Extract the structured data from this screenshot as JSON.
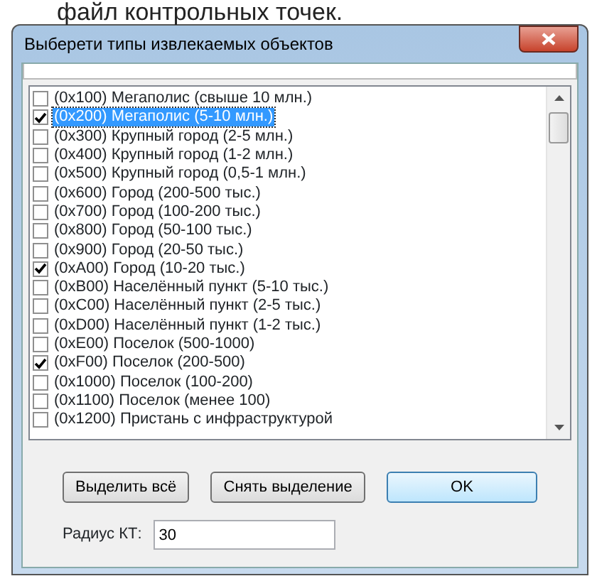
{
  "caption": "файл контрольных точек.",
  "window": {
    "title": "Выберети типы извлекаемых объектов"
  },
  "items": [
    {
      "label": "(0x100) Мегаполис (свыше 10 млн.)",
      "checked": false,
      "selected": false
    },
    {
      "label": "(0x200) Мегаполис (5-10 млн.)",
      "checked": true,
      "selected": true
    },
    {
      "label": "(0x300) Крупный город (2-5 млн.)",
      "checked": false,
      "selected": false
    },
    {
      "label": "(0x400) Крупный город (1-2 млн.)",
      "checked": false,
      "selected": false
    },
    {
      "label": "(0x500) Крупный город (0,5-1 млн.)",
      "checked": false,
      "selected": false
    },
    {
      "label": "(0x600) Город (200-500 тыс.)",
      "checked": false,
      "selected": false
    },
    {
      "label": "(0x700) Город (100-200 тыс.)",
      "checked": false,
      "selected": false
    },
    {
      "label": "(0x800) Город (50-100 тыс.)",
      "checked": false,
      "selected": false
    },
    {
      "label": "(0x900) Город (20-50 тыс.)",
      "checked": false,
      "selected": false
    },
    {
      "label": "(0xA00) Город (10-20 тыс.)",
      "checked": true,
      "selected": false
    },
    {
      "label": "(0xB00) Населённый пункт (5-10 тыс.)",
      "checked": false,
      "selected": false
    },
    {
      "label": "(0xC00) Населённый пункт (2-5 тыс.)",
      "checked": false,
      "selected": false
    },
    {
      "label": "(0xD00) Населённый пункт (1-2 тыс.)",
      "checked": false,
      "selected": false
    },
    {
      "label": "(0xE00) Поселок (500-1000)",
      "checked": false,
      "selected": false
    },
    {
      "label": "(0xF00) Поселок (200-500)",
      "checked": true,
      "selected": false
    },
    {
      "label": "(0x1000) Поселок (100-200)",
      "checked": false,
      "selected": false
    },
    {
      "label": "(0x1100) Поселок (менее 100)",
      "checked": false,
      "selected": false
    },
    {
      "label": "(0x1200) Пристань с инфраструктурой",
      "checked": false,
      "selected": false
    }
  ],
  "buttons": [
    {
      "label": "Выделить всё",
      "default": false
    },
    {
      "label": "Снять выделение",
      "default": false
    },
    {
      "label": "OK",
      "default": true
    }
  ],
  "radius": {
    "label": "Радиус КТ:",
    "value": "30"
  }
}
